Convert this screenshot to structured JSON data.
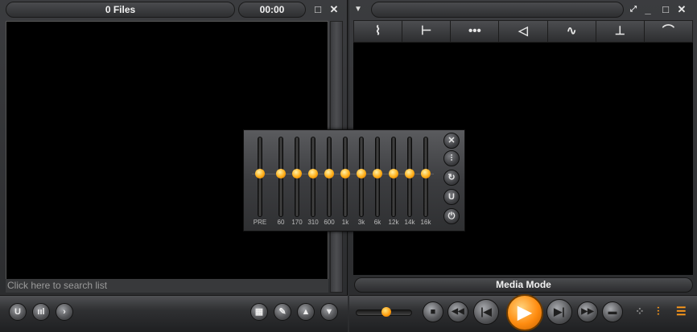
{
  "playlist": {
    "title": "0 Files",
    "time": "00:00",
    "search_placeholder": "Click here to search list",
    "restore_icon": "□",
    "close_icon": "✕"
  },
  "player": {
    "mode_label": "Media Mode",
    "tools": [
      {
        "icon": "curve-icon",
        "glyph": "⌇"
      },
      {
        "icon": "trim-icon",
        "glyph": "⊢"
      },
      {
        "icon": "dots-icon",
        "glyph": "•••"
      },
      {
        "icon": "rewind-angle-icon",
        "glyph": "◁"
      },
      {
        "icon": "wave-icon",
        "glyph": "∿"
      },
      {
        "icon": "step-icon",
        "glyph": "⊥"
      },
      {
        "icon": "arch-icon",
        "glyph": "⌒"
      }
    ]
  },
  "equalizer": {
    "bands": [
      "PRE",
      "60",
      "170",
      "310",
      "600",
      "1k",
      "3k",
      "6k",
      "12k",
      "14k",
      "16k"
    ],
    "levels": [
      0,
      0,
      0,
      0,
      0,
      0,
      0,
      0,
      0,
      0,
      0
    ]
  },
  "colors": {
    "accent": "#ff9a1a",
    "background": "#2c2d2f",
    "display": "#000000"
  }
}
